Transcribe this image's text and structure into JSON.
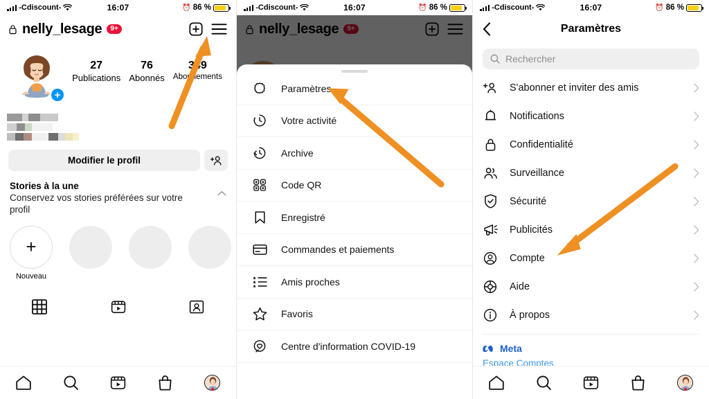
{
  "status_bar": {
    "carrier": "-Cdiscount-",
    "time": "16:07",
    "battery_percent": "86 %",
    "wifi_icon": "wifi-icon",
    "alarm_icon": "alarm-icon",
    "signal_icon": "cellular-signal-icon",
    "battery_color": "#f7d117"
  },
  "profile": {
    "lock_icon": "lock-icon",
    "username": "nelly_lesage",
    "new_posts_badge": "9+",
    "add_icon": "plus-square-icon",
    "menu_icon": "hamburger-menu-icon",
    "avatar_icon": "avatar",
    "add_story_icon": "plus-circle-icon",
    "stats": [
      {
        "number": "27",
        "label": "Publications"
      },
      {
        "number": "76",
        "label": "Abonnés"
      },
      {
        "number": "349",
        "label": "Abonnements"
      }
    ],
    "edit_profile_label": "Modifier le profil",
    "add_person_icon": "add-person-icon",
    "highlights_title": "Stories à la une",
    "highlights_subtitle": "Conservez vos stories préférées sur votre profil",
    "collapse_icon": "chevron-up-icon",
    "new_highlight_label": "Nouveau",
    "tabs": [
      "grid-tab-icon",
      "reels-tab-icon",
      "tagged-tab-icon"
    ]
  },
  "menu_sheet": {
    "items": [
      {
        "icon": "settings-gear-icon",
        "label": "Paramètres"
      },
      {
        "icon": "activity-clock-icon",
        "label": "Votre activité"
      },
      {
        "icon": "archive-icon",
        "label": "Archive"
      },
      {
        "icon": "qr-code-icon",
        "label": "Code QR"
      },
      {
        "icon": "bookmark-icon",
        "label": "Enregistré"
      },
      {
        "icon": "credit-card-icon",
        "label": "Commandes et paiements"
      },
      {
        "icon": "close-friends-icon",
        "label": "Amis proches"
      },
      {
        "icon": "star-icon",
        "label": "Favoris"
      },
      {
        "icon": "covid-info-icon",
        "label": "Centre d'information COVID-19"
      }
    ]
  },
  "settings": {
    "back_icon": "back-chevron-icon",
    "title": "Paramètres",
    "search_icon": "search-icon",
    "search_placeholder": "Rechercher",
    "search_value": "",
    "items": [
      {
        "icon": "add-friends-icon",
        "label": "S'abonner et inviter des amis"
      },
      {
        "icon": "bell-icon",
        "label": "Notifications"
      },
      {
        "icon": "lock-icon",
        "label": "Confidentialité"
      },
      {
        "icon": "people-icon",
        "label": "Surveillance"
      },
      {
        "icon": "shield-check-icon",
        "label": "Sécurité"
      },
      {
        "icon": "megaphone-icon",
        "label": "Publicités"
      },
      {
        "icon": "account-circle-icon",
        "label": "Compte"
      },
      {
        "icon": "lifebuoy-icon",
        "label": "Aide"
      },
      {
        "icon": "info-circle-icon",
        "label": "À propos"
      }
    ],
    "chevron_icon": "chevron-right-icon",
    "meta_icon": "meta-logo-icon",
    "meta_label": "Meta",
    "accounts_center_label": "Espace Comptes"
  },
  "bottom_nav": {
    "items": [
      "home-icon",
      "search-icon",
      "reels-icon",
      "shop-icon",
      "profile-avatar-icon"
    ]
  },
  "annotations": {
    "arrow_color": "#ef9023",
    "arrows": [
      {
        "name": "arrow-to-hamburger-menu",
        "panel": "profile"
      },
      {
        "name": "arrow-to-parametres",
        "panel": "menu"
      },
      {
        "name": "arrow-to-compte",
        "panel": "settings"
      }
    ]
  }
}
